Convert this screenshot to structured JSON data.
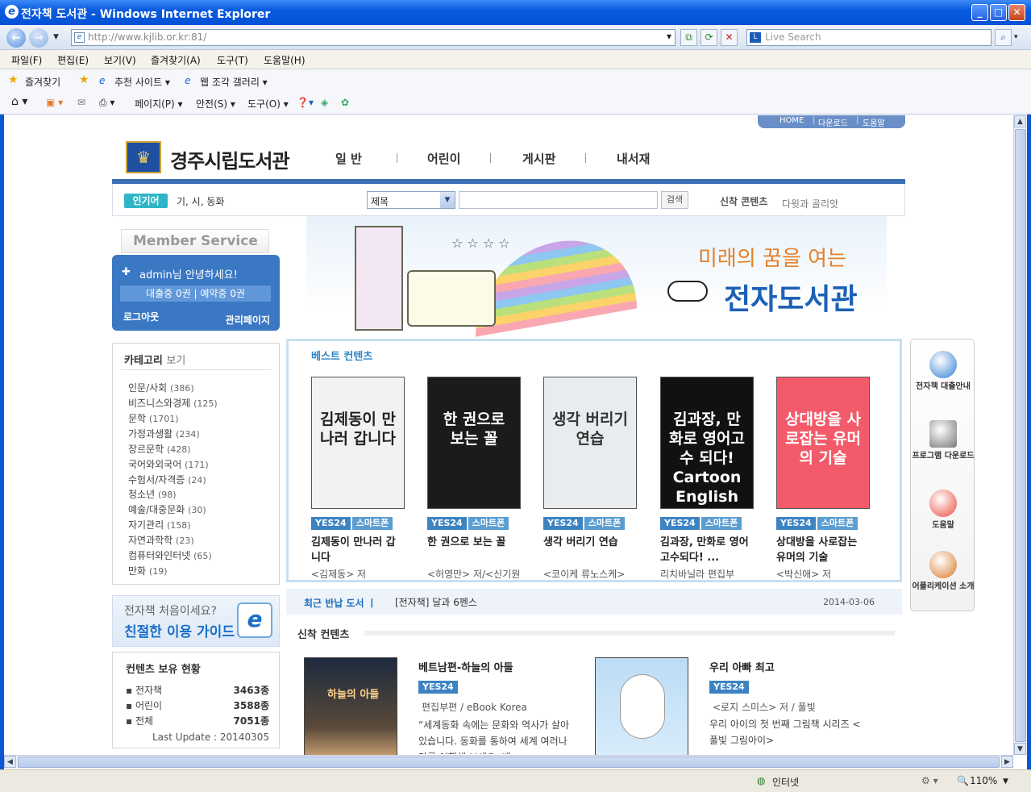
{
  "window": {
    "title": "전자책 도서관 - Windows Internet Explorer"
  },
  "address": {
    "url": "http://www.kjlib.or.kr:81/",
    "search_placeholder": "Live Search"
  },
  "menu": [
    "파일(F)",
    "편집(E)",
    "보기(V)",
    "즐겨찾기(A)",
    "도구(T)",
    "도움말(H)"
  ],
  "favbar": {
    "favorites": "즐겨찾기",
    "suggested": "추천 사이트 ▾",
    "gallery": "웹 조각 갤러리 ▾"
  },
  "cmdbar": {
    "page": "페이지(P) ▾",
    "safety": "안전(S) ▾",
    "tools": "도구(O) ▾"
  },
  "toplinks": [
    "HOME",
    "다운로드",
    "도움말"
  ],
  "site": {
    "name": "경주시립도서관",
    "nav": [
      "일 반",
      "어린이",
      "게시판",
      "내서재"
    ]
  },
  "search": {
    "popular_label": "인기어",
    "popular_words": "기, 시, 동화",
    "field": "제목",
    "button": "검색",
    "new_label": "신착 콘텐츠",
    "new_text": "다윗과 골리앗"
  },
  "banner": {
    "subtitle": "미래의 꿈을 여는",
    "title": "전자도서관"
  },
  "member": {
    "title": "Member Service",
    "greeting": "admin님 안녕하세요!",
    "loan": "대출중 0권 | 예약중 0권",
    "logout": "로그아웃",
    "admin": "관리페이지"
  },
  "categories": {
    "title": "카테고리",
    "title_suffix": "보기",
    "items": [
      {
        "name": "인문/사회",
        "count": "(386)"
      },
      {
        "name": "비즈니스와경제",
        "count": "(125)"
      },
      {
        "name": "문학",
        "count": "(1701)"
      },
      {
        "name": "가정과생활",
        "count": "(234)"
      },
      {
        "name": "장르문학",
        "count": "(428)"
      },
      {
        "name": "국어와외국어",
        "count": "(171)"
      },
      {
        "name": "수험서/자격증",
        "count": "(24)"
      },
      {
        "name": "청소년",
        "count": "(98)"
      },
      {
        "name": "예술/대중문화",
        "count": "(30)"
      },
      {
        "name": "자기관리",
        "count": "(158)"
      },
      {
        "name": "자연과학학",
        "count": "(23)"
      },
      {
        "name": "컴퓨터와인터넷",
        "count": "(65)"
      },
      {
        "name": "만화",
        "count": "(19)"
      }
    ]
  },
  "guide": {
    "line1": "전자책 처음이세요?",
    "line2": "친절한 이용 가이드"
  },
  "holdings": {
    "title": "컨텐츠 보유 현황",
    "rows": [
      {
        "label": "전자책",
        "value": "3463종"
      },
      {
        "label": "어린이",
        "value": "3588종"
      },
      {
        "label": "전체",
        "value": "7051종"
      }
    ],
    "updated": "Last Update : 20140305"
  },
  "best": {
    "title": "베스트 컨텐츠",
    "tag1": "YES24",
    "tag2": "스마트폰",
    "books": [
      {
        "title": "김제동이 만나러 갑니다",
        "author": "<김제동> 저",
        "cover_text": "김제동이 만나러 갑니다",
        "cover_bg": "#f2f2f2",
        "cover_fg": "#222"
      },
      {
        "title": "한 권으로 보는 꼴",
        "author": "<허영만> 저/<신기원> 감수",
        "cover_text": "한 권으로 보는 꼴",
        "cover_bg": "#1b1b1b",
        "cover_fg": "#fff"
      },
      {
        "title": "생각 버리기 연습",
        "author": "<코이케 류노스케> 저/<유윤한> 역",
        "cover_text": "생각 버리기 연습",
        "cover_bg": "#e9ecef",
        "cover_fg": "#333"
      },
      {
        "title": "김과장, 만화로 영어고수되다! ...",
        "author": "리치바닐라 편집부",
        "cover_text": "김과장, 만화로 영어고수 되다! Cartoon English",
        "cover_bg": "#111",
        "cover_fg": "#fff"
      },
      {
        "title": "상대방을 사로잡는 유머의 기술",
        "author": "<박신애> 저",
        "cover_text": "상대방을 사로잡는 유머의 기술",
        "cover_bg": "#f45b6a",
        "cover_fg": "#fff"
      }
    ]
  },
  "quick": [
    {
      "label": "전자책 대출안내",
      "color": "#2f7dd1"
    },
    {
      "label": "프로그램 다운로드",
      "color": "#777"
    },
    {
      "label": "도움말",
      "color": "#e94b3c"
    },
    {
      "label": "어플리케이션 소개",
      "color": "#d9792a"
    }
  ],
  "recent": {
    "label": "최근 반납 도서 ㅣ",
    "title": "[전자책] 달과 6펜스",
    "date": "2014-03-06"
  },
  "newc": {
    "title": "신착 컨텐츠",
    "tag": "YES24",
    "items": [
      {
        "title": "베트남편-하늘의 아들",
        "meta": "편집부편 / eBook Korea",
        "desc": "“세계동화 속에는 문화와 역사가 살아 있습니다. 동화를 통하여 세계 여러나라를 여행해 보세요. 베",
        "cover_text": "하늘의 아들"
      },
      {
        "title": "우리 아빠 최고",
        "meta": "<로지 스미스> 저 / 풀빛",
        "desc": "우리 아이의 첫 번째 그림책 시리즈 <풀빛 그림아이>",
        "cover_text": ""
      }
    ]
  },
  "status": {
    "zone": "인터넷",
    "zoom": "110%"
  }
}
